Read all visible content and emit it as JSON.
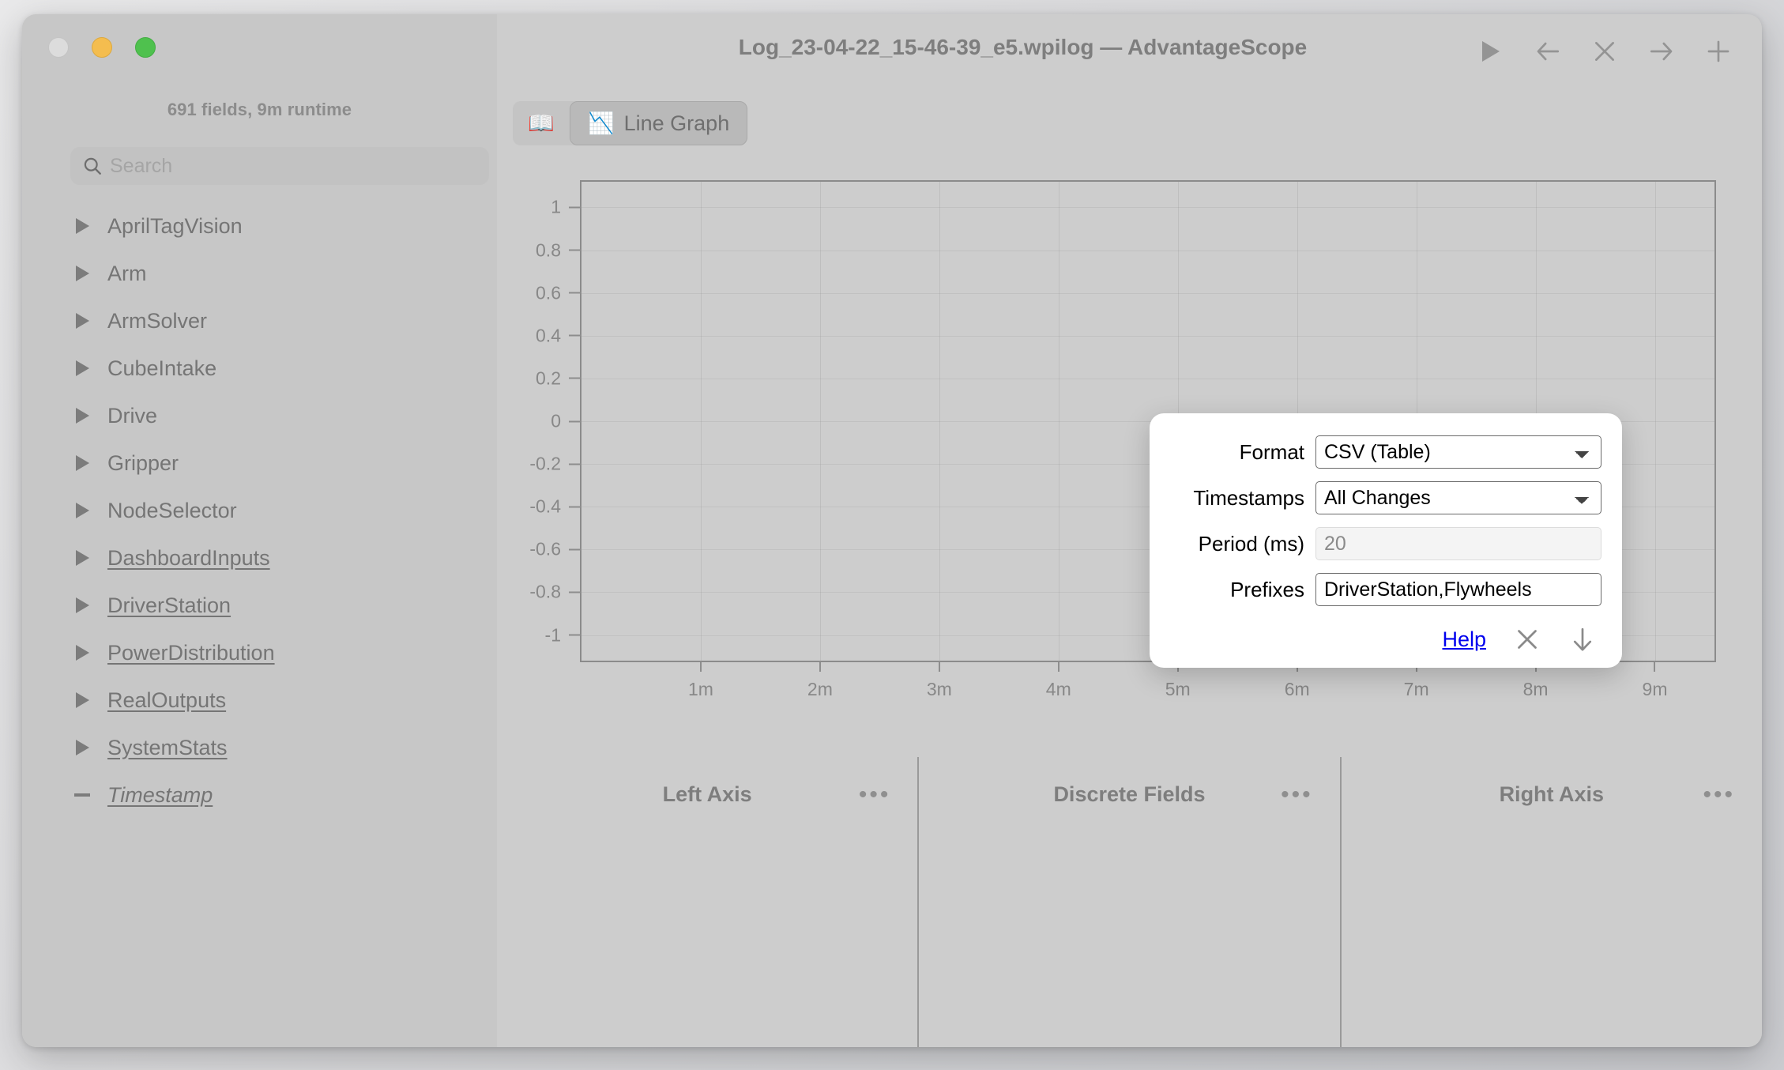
{
  "window": {
    "title": "Log_23-04-22_15-46-39_e5.wpilog — AdvantageScope",
    "traffic_lights": [
      "close",
      "minimize",
      "maximize"
    ],
    "controls": [
      {
        "name": "play-button",
        "icon": "play-icon"
      },
      {
        "name": "back-button",
        "icon": "arrow-left-icon"
      },
      {
        "name": "close-tab-button",
        "icon": "close-icon"
      },
      {
        "name": "forward-button",
        "icon": "arrow-right-icon"
      },
      {
        "name": "new-tab-button",
        "icon": "plus-icon"
      }
    ]
  },
  "sidebar": {
    "field_count": "691 fields, 9m runtime",
    "search": {
      "placeholder": "Search",
      "value": "",
      "icon": "search-icon"
    },
    "items": [
      {
        "label": "AprilTagVision",
        "marker": "triangle",
        "underline": false,
        "italic": false
      },
      {
        "label": "Arm",
        "marker": "triangle",
        "underline": false,
        "italic": false
      },
      {
        "label": "ArmSolver",
        "marker": "triangle",
        "underline": false,
        "italic": false
      },
      {
        "label": "CubeIntake",
        "marker": "triangle",
        "underline": false,
        "italic": false
      },
      {
        "label": "Drive",
        "marker": "triangle",
        "underline": false,
        "italic": false
      },
      {
        "label": "Gripper",
        "marker": "triangle",
        "underline": false,
        "italic": false
      },
      {
        "label": "NodeSelector",
        "marker": "triangle",
        "underline": false,
        "italic": false
      },
      {
        "label": "DashboardInputs",
        "marker": "triangle",
        "underline": true,
        "italic": false
      },
      {
        "label": "DriverStation",
        "marker": "triangle",
        "underline": true,
        "italic": false
      },
      {
        "label": "PowerDistribution",
        "marker": "triangle",
        "underline": true,
        "italic": false
      },
      {
        "label": "RealOutputs",
        "marker": "triangle",
        "underline": true,
        "italic": false
      },
      {
        "label": "SystemStats",
        "marker": "triangle",
        "underline": true,
        "italic": false
      },
      {
        "label": "Timestamp",
        "marker": "dash",
        "underline": true,
        "italic": true
      }
    ]
  },
  "tabs": [
    {
      "label": "",
      "icon": "book-icon",
      "active": false,
      "name": "tab-home"
    },
    {
      "label": "Line Graph",
      "icon": "line-graph-icon",
      "active": true,
      "name": "tab-line-graph"
    }
  ],
  "bottom_panels": [
    {
      "title": "Left Axis",
      "menu": "•••"
    },
    {
      "title": "Discrete Fields",
      "menu": "•••"
    },
    {
      "title": "Right Axis",
      "menu": "•••"
    }
  ],
  "dialog": {
    "name": "export-options-dialog",
    "rows": [
      {
        "label": "Format",
        "type": "select",
        "value": "CSV (Table)",
        "disabled": false
      },
      {
        "label": "Timestamps",
        "type": "select",
        "value": "All Changes",
        "disabled": false
      },
      {
        "label": "Period (ms)",
        "type": "input",
        "value": "20",
        "disabled": true
      },
      {
        "label": "Prefixes",
        "type": "input",
        "value": "DriverStation,Flywheels",
        "disabled": false
      }
    ],
    "format_options": [
      "CSV (Table)"
    ],
    "timestamps_options": [
      "All Changes"
    ],
    "help_label": "Help",
    "cancel_icon": "close-icon",
    "confirm_icon": "arrow-down-icon",
    "link_color": "#0000ee"
  },
  "chart_data": {
    "type": "line",
    "title": "",
    "xlabel": "",
    "ylabel": "",
    "series": [],
    "x_ticks": [
      "1m",
      "2m",
      "3m",
      "4m",
      "5m",
      "6m",
      "7m",
      "8m",
      "9m"
    ],
    "x_tick_values": [
      60,
      120,
      180,
      240,
      300,
      360,
      420,
      480,
      540
    ],
    "y_ticks": [
      "1",
      "0.8",
      "0.6",
      "0.4",
      "0.2",
      "0",
      "-0.2",
      "-0.4",
      "-0.6",
      "-0.8",
      "-1"
    ],
    "y_tick_values": [
      1,
      0.8,
      0.6,
      0.4,
      0.2,
      0,
      -0.2,
      -0.4,
      -0.6,
      -0.8,
      -1
    ],
    "xlim": [
      0,
      570
    ],
    "ylim": [
      -1.12,
      1.12
    ],
    "grid": true,
    "legend": "none"
  },
  "colors": {
    "window_bg": "#cccccc",
    "sidebar_bg": "#c7c7c7",
    "main_bg": "#cdcdcd",
    "text_muted": "#7e7e7e",
    "link": "#0000ee",
    "plot_border": "#8b8b8b"
  }
}
